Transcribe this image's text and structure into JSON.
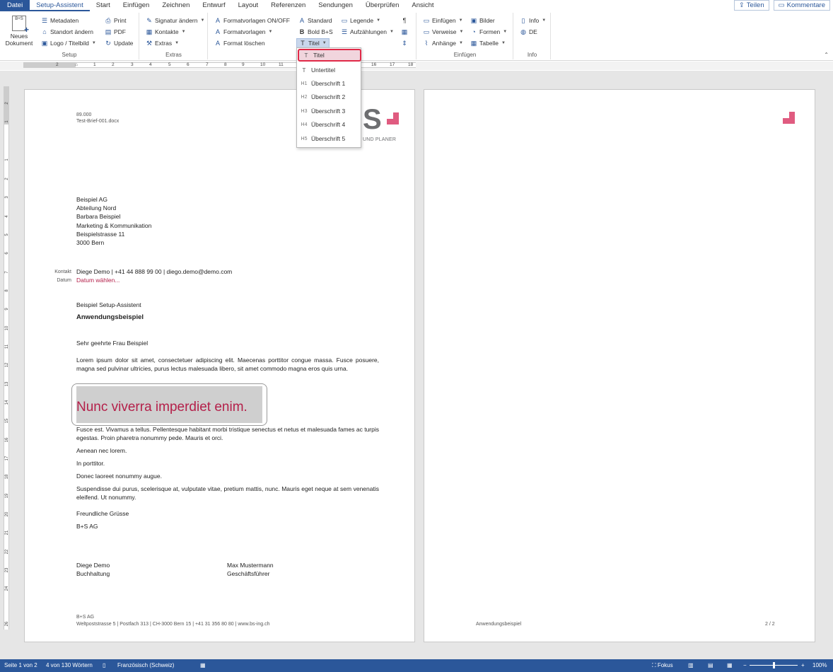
{
  "menubar": {
    "tabs": [
      "Datei",
      "Setup-Assistent",
      "Start",
      "Einfügen",
      "Zeichnen",
      "Entwurf",
      "Layout",
      "Referenzen",
      "Sendungen",
      "Überprüfen",
      "Ansicht"
    ],
    "share": "Teilen",
    "comments": "Kommentare"
  },
  "ribbon": {
    "setup": {
      "label": "Setup",
      "neues": "Neues",
      "dokument": "Dokument",
      "metadaten": "Metadaten",
      "standort": "Standort ändern",
      "logo": "Logo / Titelbild",
      "print": "Print",
      "pdf": "PDF",
      "update": "Update"
    },
    "extras": {
      "label": "Extras",
      "signatur": "Signatur ändern",
      "kontakte": "Kontakte",
      "extras": "Extras"
    },
    "format": {
      "onoff": "Formatvorlagen ON/OFF",
      "vorlagen": "Formatvorlagen",
      "loeschen": "Format löschen"
    },
    "styles": {
      "standard": "Standard",
      "bold": "Bold B+S",
      "titel": "Titel",
      "legende": "Legende",
      "aufzaehlungen": "Aufzählungen"
    },
    "einfuegen": {
      "label": "Einfügen",
      "einfuegen": "Einfügen",
      "verweise": "Verweise",
      "anhaenge": "Anhänge",
      "bilder": "Bilder",
      "formen": "Formen",
      "tabelle": "Tabelle"
    },
    "info": {
      "label": "Info",
      "info": "Info",
      "de": "DE"
    }
  },
  "ruler": {
    "h": [
      "2",
      "1",
      "1",
      "2",
      "3",
      "4",
      "5",
      "6",
      "7",
      "8",
      "9",
      "10",
      "11",
      "16",
      "17",
      "18"
    ],
    "v": [
      "2",
      "1",
      "1",
      "2",
      "3",
      "4",
      "5",
      "6",
      "7",
      "8",
      "9",
      "10",
      "11",
      "12",
      "13",
      "14",
      "15",
      "16",
      "17",
      "18",
      "19",
      "20",
      "21",
      "22",
      "23",
      "24",
      "26"
    ]
  },
  "dropdown": {
    "items": [
      {
        "icon": "T",
        "label": "Titel"
      },
      {
        "icon": "T",
        "label": "Untertitel"
      },
      {
        "icon": "H1",
        "label": "Überschrift 1"
      },
      {
        "icon": "H2",
        "label": "Überschrift 2"
      },
      {
        "icon": "H3",
        "label": "Überschrift 3"
      },
      {
        "icon": "H4",
        "label": "Überschrift 4"
      },
      {
        "icon": "H5",
        "label": "Überschrift 5"
      }
    ]
  },
  "page1": {
    "ref1": "89.000",
    "ref2": "Test-Brief-001.docx",
    "logo_s": "S",
    "logo_sub": "UND PLANER",
    "address": [
      "Beispiel AG",
      "Abteilung Nord",
      "Barbara Beispiel",
      "Marketing & Kommunikation",
      "Beispielstrasse 11",
      "3000 Bern"
    ],
    "kontakt_label": "Kontakt",
    "kontakt_value": "Diege Demo | +41 44 888 99 00 | diego.demo@demo.com",
    "datum_label": "Datum",
    "datum_value": "Datum wählen...",
    "subject_small": "Beispiel Setup-Assistent",
    "subject": "Anwendungsbeispiel",
    "salutation": "Sehr geehrte Frau Beispiel",
    "p1": "Lorem ipsum dolor sit amet, consectetuer adipiscing elit. Maecenas porttitor congue massa. Fusce posuere, magna sed pulvinar ultricies, purus lectus malesuada libero, sit amet commodo magna eros quis urna.",
    "heading": "Nunc viverra imperdiet enim.",
    "p2": "Fusce est. Vivamus a tellus. Pellentesque habitant morbi tristique senectus et netus et malesuada fames ac turpis egestas. Proin pharetra nonummy pede. Mauris et orci.",
    "p3": "Aenean nec lorem.",
    "p4": "In porttitor.",
    "p5": "Donec laoreet nonummy augue.",
    "p6": "Suspendisse dui purus, scelerisque at, vulputate vitae, pretium mattis, nunc. Mauris eget neque at sem venenatis eleifend. Ut nonummy.",
    "closing": "Freundliche Grüsse",
    "company": "B+S AG",
    "sig1_name": "Diege Demo",
    "sig1_role": "Buchhaltung",
    "sig2_name": "Max Mustermann",
    "sig2_role": "Geschäftsführer",
    "footer1": "B+S AG",
    "footer2": "Weltpoststrasse 5 | Postfach 313 | CH-3000 Bern 15 | +41 31 356 80 80 | www.bs-ing.ch"
  },
  "page2": {
    "footer_center": "Anwendungsbeispiel",
    "page_num": "2 / 2"
  },
  "statusbar": {
    "page": "Seite 1 von 2",
    "words": "4 von 130 Wörtern",
    "lang": "Französisch (Schweiz)",
    "focus": "Fokus",
    "zoom": "100%",
    "zoom_fraction": 0.5
  },
  "colors": {
    "brand": "#2b579a",
    "accent": "#b4204a",
    "logo_pink": "#e05b80"
  }
}
